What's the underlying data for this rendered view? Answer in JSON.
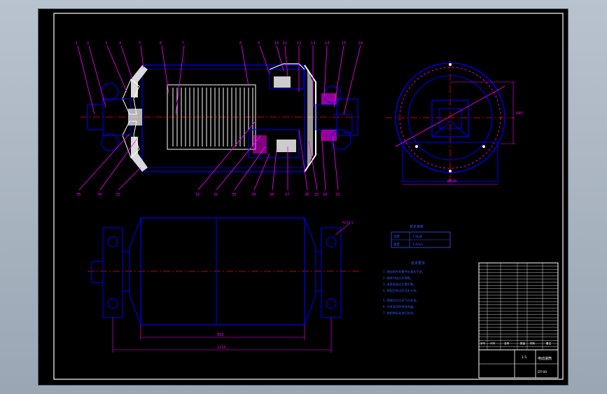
{
  "colors": {
    "background": "#000000",
    "border": "#ffffff",
    "outline": "#0000ff",
    "leader": "#ff00ff",
    "centerline": "#ff0000",
    "hatch": "#ffffff",
    "text_blue": "#3355ff"
  },
  "balloons_top": [
    "1",
    "2",
    "3",
    "4",
    "5",
    "6",
    "7",
    "8",
    "9",
    "10",
    "11",
    "12",
    "13",
    "14",
    "15",
    "16"
  ],
  "balloons_bottom": [
    "35",
    "34",
    "33",
    "32",
    "31",
    "30",
    "29",
    "28",
    "27",
    "26",
    "25",
    "24",
    "23"
  ],
  "dimensions": {
    "overall_length": "1210",
    "drum_length": "950",
    "end_view_height": "640",
    "end_view_diameter": "Ø630"
  },
  "surface_note": "Ra12.5",
  "tech_table": {
    "title": "技术参数",
    "rows": [
      [
        "功率",
        "7.5kW"
      ],
      [
        "速度",
        "1.6m/s"
      ]
    ]
  },
  "tech_requirements": {
    "title": "技术要求",
    "lines": [
      "1. 装配前所有零件应清洗干净。",
      "2. 轴承内加注润滑脂。",
      "3. 滚筒表面应光滑平整。",
      "4. 装配后转动灵活无卡滞。",
      "5. 焊缝应均匀无气孔夹渣。",
      "6. 外表面涂防锈漆两遍。",
      "7. 按相关标准进行检验。"
    ]
  },
  "title_block": {
    "drawing_name": "电动滚筒",
    "drawing_number": "DT-00",
    "scale": "1:5",
    "parts_header": [
      "序号",
      "代号",
      "名称",
      "数量",
      "材料",
      "备注"
    ]
  }
}
